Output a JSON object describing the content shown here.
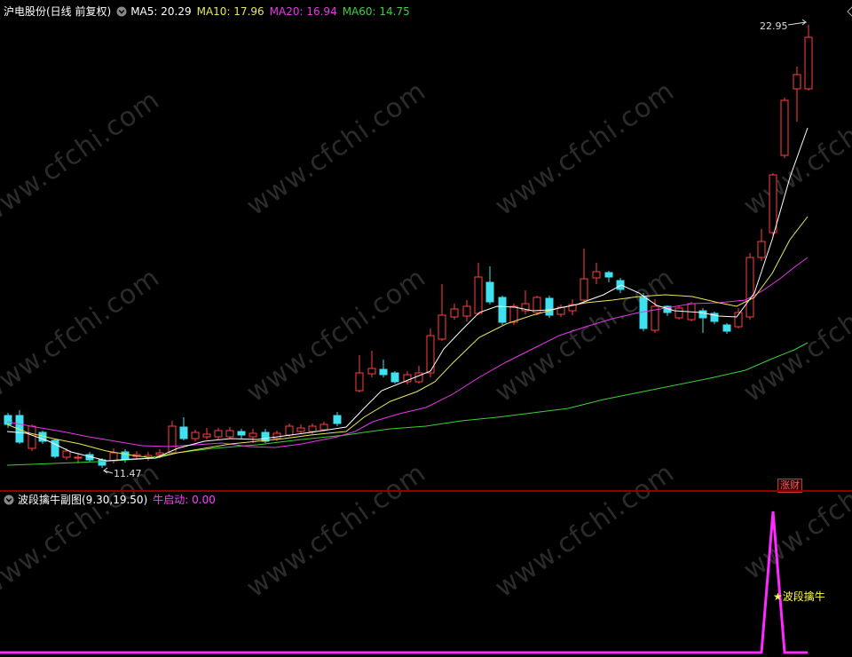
{
  "main": {
    "title": "沪电股份(日线 前复权)",
    "ma5": "MA5: 20.29",
    "ma10": "MA10: 17.96",
    "ma20": "MA20: 16.94",
    "ma60": "MA60: 14.75",
    "high_label": "22.95",
    "low_label": "11.47",
    "badge": "涨财",
    "colors": {
      "ma5": "#ffffff",
      "ma10": "#e8e85a",
      "ma20": "#e838e8",
      "ma60": "#3ad03a",
      "up": "#ff4040",
      "down": "#40e0f0",
      "title": "#ffffff"
    }
  },
  "sub": {
    "title": "波段擒牛副图(9.30,19.50)",
    "value": "牛启动: 0.00",
    "signal": "波段擒牛",
    "signal_icon": "star-icon"
  },
  "watermark": "www.cfchi.com",
  "icons": [
    "chevron-down-icon",
    "diamond-icon",
    "settings-icon"
  ]
}
